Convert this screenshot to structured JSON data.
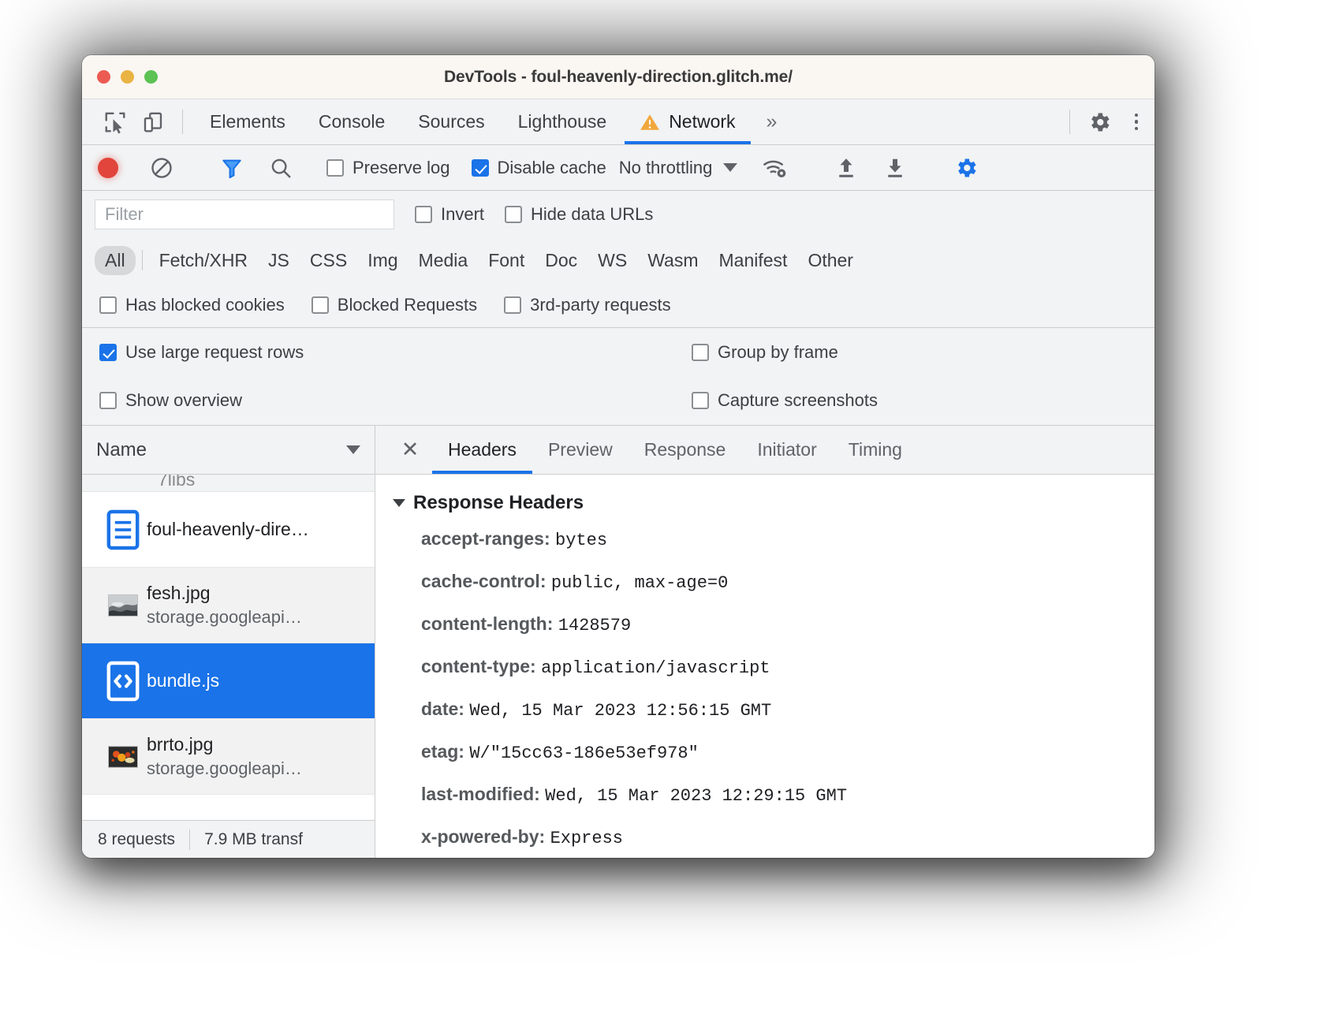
{
  "window": {
    "title": "DevTools - foul-heavenly-direction.glitch.me/",
    "traffic_lights": [
      "close",
      "minimize",
      "maximize"
    ]
  },
  "main_tabs": {
    "inspect_icon": "inspect-element-icon",
    "device_icon": "device-toolbar-icon",
    "items": [
      {
        "label": "Elements",
        "active": false,
        "warning": false
      },
      {
        "label": "Console",
        "active": false,
        "warning": false
      },
      {
        "label": "Sources",
        "active": false,
        "warning": false
      },
      {
        "label": "Lighthouse",
        "active": false,
        "warning": false
      },
      {
        "label": "Network",
        "active": true,
        "warning": true
      }
    ],
    "more_label": "»",
    "settings_icon": "gear-icon",
    "menu_icon": "kebab-menu-icon"
  },
  "network_toolbar": {
    "record_icon": "record-button",
    "clear_icon": "clear-icon",
    "filter_icon": "filter-funnel-icon",
    "search_icon": "search-icon",
    "preserve_log": {
      "label": "Preserve log",
      "checked": false
    },
    "disable_cache": {
      "label": "Disable cache",
      "checked": true
    },
    "throttling": {
      "value": "No throttling"
    },
    "network_conditions_icon": "wifi-settings-icon",
    "import_icon": "upload-har-icon",
    "export_icon": "download-har-icon",
    "settings_icon": "network-settings-gear-icon"
  },
  "filter_bar": {
    "filter_placeholder": "Filter",
    "filter_value": "",
    "invert": {
      "label": "Invert",
      "checked": false
    },
    "hide_data_urls": {
      "label": "Hide data URLs",
      "checked": false
    }
  },
  "resource_types": [
    {
      "label": "All",
      "active": true
    },
    {
      "label": "Fetch/XHR",
      "active": false
    },
    {
      "label": "JS",
      "active": false
    },
    {
      "label": "CSS",
      "active": false
    },
    {
      "label": "Img",
      "active": false
    },
    {
      "label": "Media",
      "active": false
    },
    {
      "label": "Font",
      "active": false
    },
    {
      "label": "Doc",
      "active": false
    },
    {
      "label": "WS",
      "active": false
    },
    {
      "label": "Wasm",
      "active": false
    },
    {
      "label": "Manifest",
      "active": false
    },
    {
      "label": "Other",
      "active": false
    }
  ],
  "blocked_filters": [
    {
      "label": "Has blocked cookies",
      "checked": false
    },
    {
      "label": "Blocked Requests",
      "checked": false
    },
    {
      "label": "3rd-party requests",
      "checked": false
    }
  ],
  "settings_pane": [
    {
      "label": "Use large request rows",
      "checked": true
    },
    {
      "label": "Group by frame",
      "checked": false
    },
    {
      "label": "Show overview",
      "checked": false
    },
    {
      "label": "Capture screenshots",
      "checked": false
    }
  ],
  "request_table": {
    "column_header": "Name",
    "sort_icon": "caret-down-icon",
    "partial_row_text": "7libs",
    "rows": [
      {
        "name": "foul-heavenly-dire…",
        "sub": "",
        "icon": "document-icon",
        "selected": false
      },
      {
        "name": "fesh.jpg",
        "sub": "storage.googleapi…",
        "icon": "image-thumbnail",
        "selected": false
      },
      {
        "name": "bundle.js",
        "sub": "",
        "icon": "script-icon",
        "selected": true
      },
      {
        "name": "brrto.jpg",
        "sub": "storage.googleapi…",
        "icon": "image-thumbnail",
        "selected": false
      }
    ],
    "status": {
      "requests": "8 requests",
      "transferred": "7.9 MB transf"
    }
  },
  "detail_panel": {
    "close_icon": "close-icon",
    "tabs": [
      {
        "label": "Headers",
        "active": true
      },
      {
        "label": "Preview",
        "active": false
      },
      {
        "label": "Response",
        "active": false
      },
      {
        "label": "Initiator",
        "active": false
      },
      {
        "label": "Timing",
        "active": false
      }
    ],
    "section_title": "Response Headers",
    "headers": [
      {
        "name": "accept-ranges:",
        "value": "bytes"
      },
      {
        "name": "cache-control:",
        "value": "public, max-age=0"
      },
      {
        "name": "content-length:",
        "value": "1428579"
      },
      {
        "name": "content-type:",
        "value": "application/javascript"
      },
      {
        "name": "date:",
        "value": "Wed, 15 Mar 2023 12:56:15 GMT"
      },
      {
        "name": "etag:",
        "value": "W/\"15cc63-186e53ef978\""
      },
      {
        "name": "last-modified:",
        "value": "Wed, 15 Mar 2023 12:29:15 GMT"
      },
      {
        "name": "x-powered-by:",
        "value": "Express"
      }
    ]
  },
  "colors": {
    "accent": "#1a73e8",
    "warning": "#f2a73b",
    "record": "#e1453c",
    "toolbar_bg": "#f1f3f4",
    "titlebar_bg": "#faf6f2"
  }
}
